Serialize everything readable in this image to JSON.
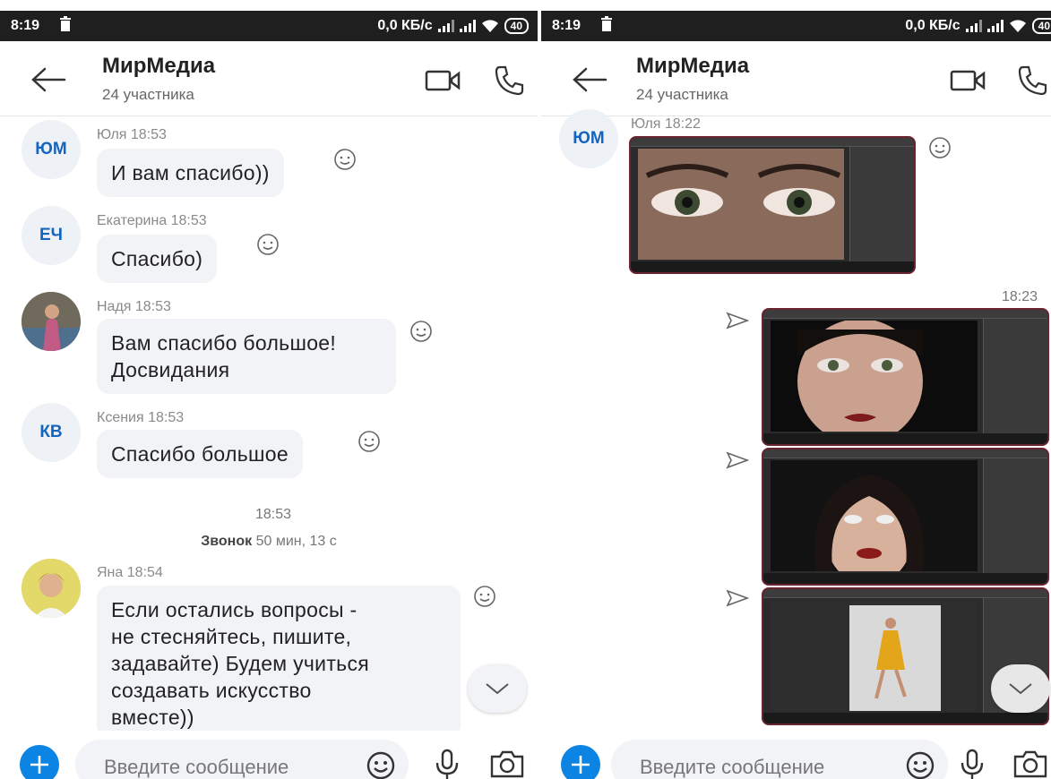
{
  "status_bar": {
    "time": "8:19",
    "network_speed": "0,0 КБ/с",
    "battery": "40"
  },
  "chat": {
    "title": "МирМедиа",
    "subtitle": "24 участника"
  },
  "left_panel": {
    "messages": [
      {
        "initials": "ЮМ",
        "sender": "Юля 18:53",
        "text": "И вам спасибо))"
      },
      {
        "initials": "ЕЧ",
        "sender": "Екатерина 18:53",
        "text": "Спасибо)"
      },
      {
        "initials": "",
        "sender": "Надя 18:53",
        "text_lines": [
          "Вам спасибо большое!",
          "Досвидания"
        ]
      },
      {
        "initials": "КВ",
        "sender": "Ксения 18:53",
        "text": "Спасибо большое"
      },
      {
        "initials": "",
        "sender": "Яна 18:54",
        "text_lines": [
          "Если остались вопросы -",
          "не стесняйтесь, пишите,",
          "задавайте) Будем учиться",
          "создавать искусство",
          "вместе))"
        ]
      }
    ],
    "call_event": {
      "time": "18:53",
      "label": "Звонок",
      "duration": "50 мин, 13 с"
    }
  },
  "right_panel": {
    "received": {
      "initials": "ЮМ",
      "sender": "Юля 18:22"
    },
    "sent_time": "18:23"
  },
  "composer": {
    "placeholder": "Введите сообщение"
  },
  "colors": {
    "accent": "#0b84e3",
    "avatar_text": "#1565c0",
    "bubble": "#f1f3f6",
    "status_bar": "#1f1f1f"
  },
  "icons": [
    "back-arrow-icon",
    "video-call-icon",
    "phone-icon",
    "smile-icon",
    "plus-icon",
    "microphone-icon",
    "camera-icon",
    "chevron-down-icon",
    "send-arrow-icon",
    "trash-icon",
    "wifi-icon",
    "signal-icon"
  ]
}
